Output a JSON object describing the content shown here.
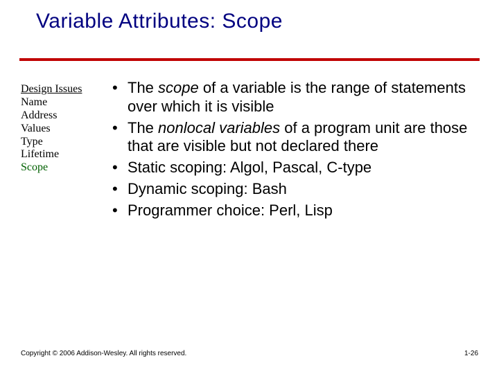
{
  "title": "Variable Attributes: Scope",
  "sidebar": {
    "heading": "Design Issues",
    "items": [
      "Name",
      "Address",
      "Values",
      "Type",
      "Lifetime"
    ],
    "active": "Scope"
  },
  "bullets": {
    "b1_pre": "The ",
    "b1_em": "scope",
    "b1_post": " of a variable is the range of statements over which it is visible",
    "b2_pre": "The ",
    "b2_em": "nonlocal variables",
    "b2_post": " of a program unit are those that are visible but not declared there",
    "b3": "Static scoping: Algol, Pascal, C-type",
    "b4": "Dynamic scoping: Bash",
    "b5": "Programmer choice: Perl, Lisp"
  },
  "footer": {
    "copyright": "Copyright © 2006 Addison-Wesley. All rights reserved.",
    "page": "1-26"
  }
}
